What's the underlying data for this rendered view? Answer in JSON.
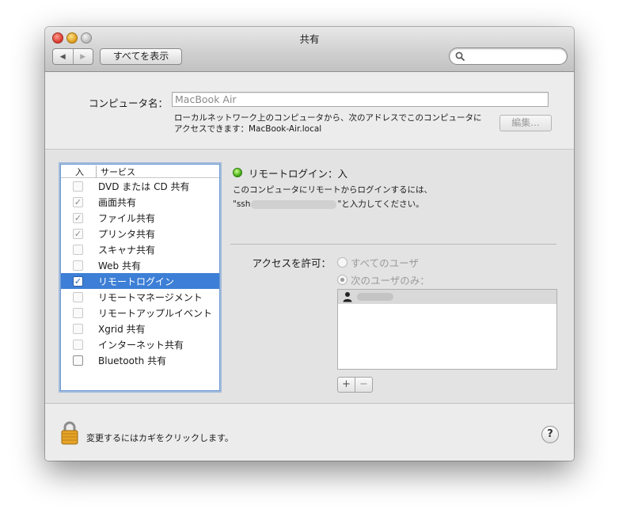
{
  "window": {
    "title": "共有"
  },
  "toolbar": {
    "back_label": "◀",
    "forward_label": "▶",
    "show_all_label": "すべてを表示",
    "search": {
      "value": "",
      "placeholder": ""
    }
  },
  "computer_name": {
    "label": "コンピュータ名：",
    "value": "MacBook Air",
    "desc_line1": "ローカルネットワーク上のコンピュータから、次のアドレスでこのコンピュータに",
    "desc_line2": "アクセスできます：MacBook-Air.local",
    "edit_label": "編集..."
  },
  "services": {
    "header_on": "入",
    "header_name": "サービス",
    "items": [
      {
        "name": "DVD または CD 共有",
        "checked": false,
        "selected": false
      },
      {
        "name": "画面共有",
        "checked": true,
        "selected": false
      },
      {
        "name": "ファイル共有",
        "checked": true,
        "selected": false
      },
      {
        "name": "プリンタ共有",
        "checked": true,
        "selected": false
      },
      {
        "name": "スキャナ共有",
        "checked": false,
        "selected": false
      },
      {
        "name": "Web 共有",
        "checked": false,
        "selected": false
      },
      {
        "name": "リモートログイン",
        "checked": true,
        "selected": true
      },
      {
        "name": "リモートマネージメント",
        "checked": false,
        "selected": false
      },
      {
        "name": "リモートアップルイベント",
        "checked": false,
        "selected": false
      },
      {
        "name": "Xgrid 共有",
        "checked": false,
        "selected": false
      },
      {
        "name": "インターネット共有",
        "checked": false,
        "selected": false
      },
      {
        "name": "Bluetooth 共有",
        "checked": false,
        "selected": false
      }
    ]
  },
  "detail": {
    "status_title": "リモートログイン：入",
    "desc_line1": "このコンピュータにリモートからログインするには、",
    "desc_prefix": "\"ssh",
    "desc_suffix": "\"と入力してください。",
    "access_label": "アクセスを許可：",
    "radio_all": "すべてのユーザ",
    "radio_only": "次のユーザのみ：",
    "add_label": "+",
    "remove_label": "−"
  },
  "footer": {
    "lock_text": "変更するにはカギをクリックします。",
    "help_label": "?"
  },
  "colors": {
    "selection": "#3d7fd6",
    "status_green": "#3aa30c"
  }
}
